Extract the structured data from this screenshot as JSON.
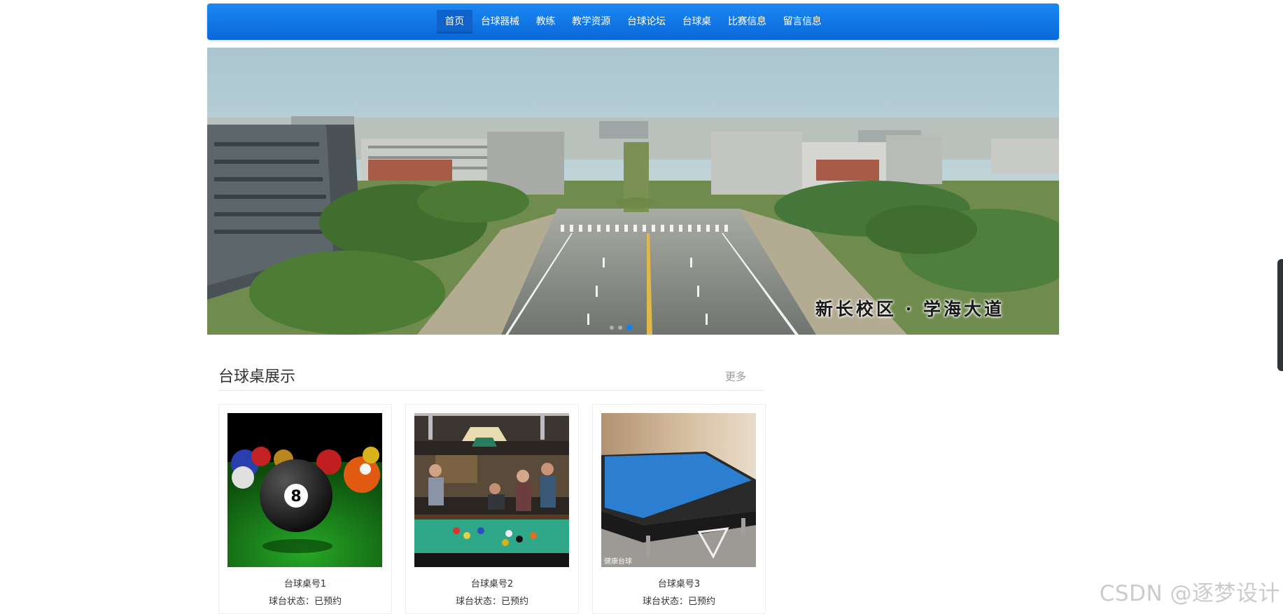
{
  "nav": {
    "items": [
      "首页",
      "台球器械",
      "教练",
      "教学资源",
      "台球论坛",
      "台球桌",
      "比赛信息",
      "留言信息"
    ],
    "active_index": 0
  },
  "banner": {
    "caption": "新长校区 · 学海大道",
    "slide_count": 3,
    "active_slide": 3
  },
  "section": {
    "title": "台球桌展示",
    "more_label": "更多"
  },
  "cards": [
    {
      "name": "台球桌号1",
      "status": "球台状态：已预约",
      "thumb": "eight-ball-photo"
    },
    {
      "name": "台球桌号2",
      "status": "球台状态：已预约",
      "thumb": "players-at-table-photo"
    },
    {
      "name": "台球桌号3",
      "status": "球台状态：已预约",
      "thumb": "blue-pool-table-photo",
      "thumb_overlay_text": "健康台球"
    }
  ],
  "watermark": "CSDN @逐梦设计",
  "colors": {
    "nav_bg": "#0a74e8",
    "nav_active_bg": "#0f62c9",
    "dot_active": "#1a7ff0",
    "more_text": "#999999"
  }
}
